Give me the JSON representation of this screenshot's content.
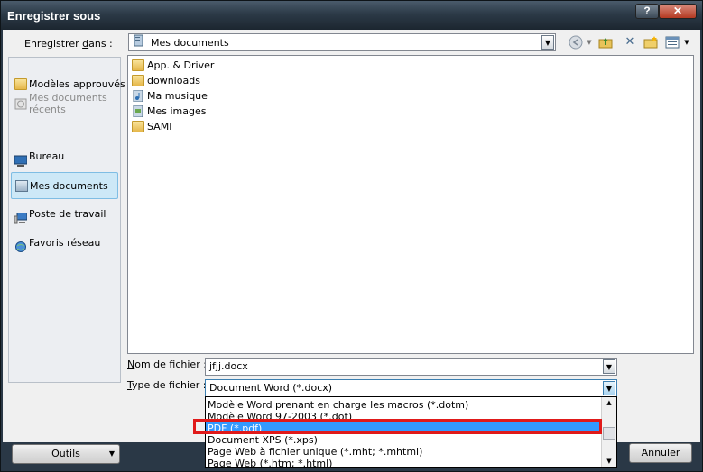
{
  "window": {
    "title": "Enregistrer sous",
    "help_label": "?",
    "close_label": "✕"
  },
  "lookin": {
    "label_pre": "Enregistrer ",
    "label_u": "d",
    "label_post": "ans :",
    "value": "Mes documents"
  },
  "places": [
    {
      "label": "Modèles approuvés",
      "icon": "folder-icon"
    },
    {
      "label": "Mes documents récents",
      "icon": "recent-documents-icon"
    },
    {
      "label": "Bureau",
      "icon": "desktop-icon"
    },
    {
      "label": "Mes documents",
      "icon": "my-documents-icon"
    },
    {
      "label": "Poste de travail",
      "icon": "computer-icon"
    },
    {
      "label": "Favoris réseau",
      "icon": "network-icon"
    }
  ],
  "files": [
    {
      "name": "App. & Driver",
      "icon": "folder-icon"
    },
    {
      "name": "downloads",
      "icon": "folder-icon"
    },
    {
      "name": "Ma musique",
      "icon": "music-folder-icon"
    },
    {
      "name": "Mes images",
      "icon": "pictures-folder-icon"
    },
    {
      "name": "SAMI",
      "icon": "folder-icon"
    }
  ],
  "filename": {
    "label_u": "N",
    "label_post": "om de fichier :",
    "value": "jfjj.docx"
  },
  "filetype": {
    "label_u": "T",
    "label_post": "ype de fichier :",
    "value": "Document Word (*.docx)",
    "options": [
      "Modèle Word prenant en charge les macros (*.dotm)",
      "Modèle Word 97-2003 (*.dot)",
      "PDF (*.pdf)",
      "Document XPS (*.xps)",
      "Page Web à fichier unique (*.mht; *.mhtml)",
      "Page Web (*.htm; *.html)"
    ],
    "selected_option": "PDF (*.pdf)"
  },
  "buttons": {
    "tools_pre": "Outi",
    "tools_u": "l",
    "tools_post": "s",
    "cancel": "Annuler"
  },
  "colors": {
    "selection": "#3399ff",
    "highlight_box": "#e01a1a"
  }
}
